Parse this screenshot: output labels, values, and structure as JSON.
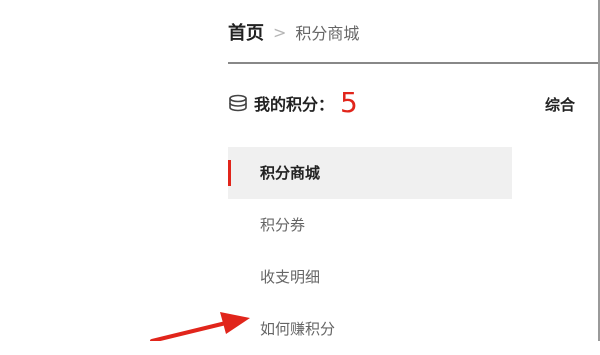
{
  "breadcrumb": {
    "home": "首页",
    "separator": ">",
    "current": "积分商城"
  },
  "points": {
    "icon": "coin-stack-icon",
    "label": "我的积分：",
    "value": "5",
    "value_color": "#e1251b"
  },
  "sort_tab": {
    "label": "综合"
  },
  "menu": {
    "items": [
      {
        "label": "积分商城",
        "active": true
      },
      {
        "label": "积分券"
      },
      {
        "label": "收支明细"
      },
      {
        "label": "如何赚积分"
      }
    ]
  },
  "annotation": {
    "icon": "red-arrow-icon",
    "color": "#e1251b"
  }
}
